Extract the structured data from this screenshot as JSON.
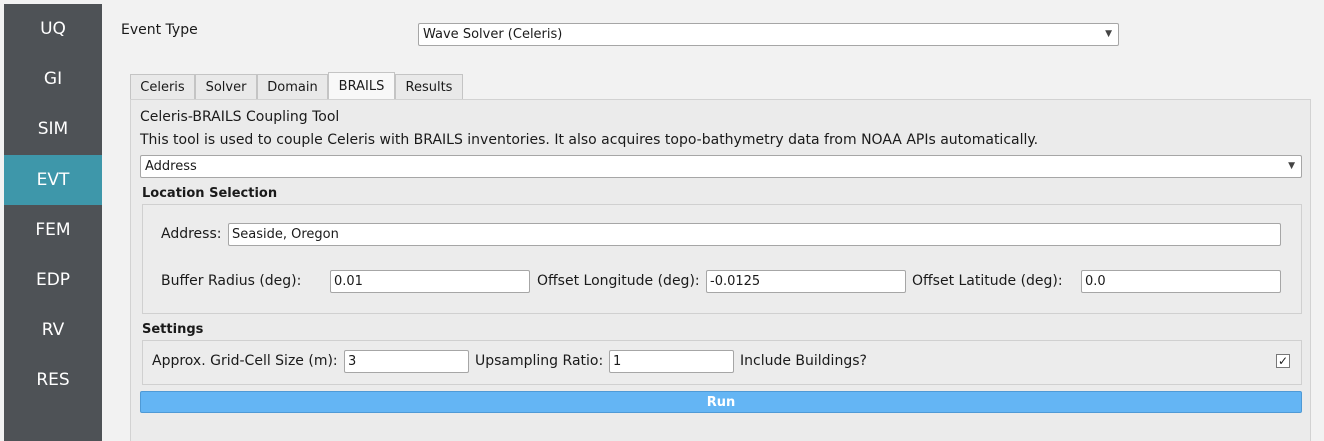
{
  "sidebar": {
    "items": [
      {
        "label": "UQ"
      },
      {
        "label": "GI"
      },
      {
        "label": "SIM"
      },
      {
        "label": "EVT"
      },
      {
        "label": "FEM"
      },
      {
        "label": "EDP"
      },
      {
        "label": "RV"
      },
      {
        "label": "RES"
      }
    ],
    "active_index": 3
  },
  "event_type": {
    "label": "Event Type",
    "selected": "Wave Solver (Celeris)"
  },
  "tabs": [
    {
      "label": "Celeris"
    },
    {
      "label": "Solver"
    },
    {
      "label": "Domain"
    },
    {
      "label": "BRAILS"
    },
    {
      "label": "Results"
    }
  ],
  "brails": {
    "title": "Celeris-BRAILS Coupling Tool",
    "description": "This tool is used to couple Celeris with BRAILS inventories. It also acquires topo-bathymetry data from NOAA APIs automatically.",
    "mode_selected": "Address",
    "location": {
      "heading": "Location Selection",
      "address_label": "Address:",
      "address_value": "Seaside, Oregon",
      "buffer_label": "Buffer Radius (deg):",
      "buffer_value": "0.01",
      "offset_lon_label": "Offset Longitude (deg):",
      "offset_lon_value": "-0.0125",
      "offset_lat_label": "Offset Latitude (deg):",
      "offset_lat_value": "0.0"
    },
    "settings": {
      "heading": "Settings",
      "grid_label": "Approx. Grid-Cell Size (m):",
      "grid_value": "3",
      "upsampling_label": "Upsampling Ratio:",
      "upsampling_value": "1",
      "buildings_label": "Include Buildings?",
      "buildings_checked": true,
      "check_glyph": "✓"
    },
    "run_label": "Run"
  },
  "icons": {
    "dropdown": "chevron-down-icon",
    "check": "check-icon"
  }
}
